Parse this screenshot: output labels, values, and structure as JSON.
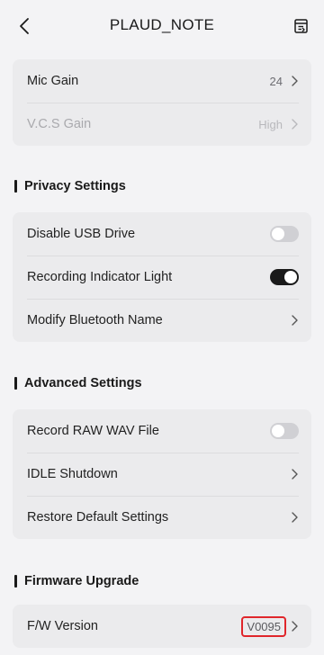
{
  "header": {
    "title": "PLAUD_NOTE",
    "back_icon": "chevron-left-icon",
    "doc_icon": "document-list-icon"
  },
  "gain": {
    "mic_gain": {
      "label": "Mic Gain",
      "value": "24"
    },
    "vcs_gain": {
      "label": "V.C.S Gain",
      "value": "High",
      "disabled": true
    }
  },
  "privacy": {
    "heading": "Privacy Settings",
    "items": [
      {
        "label": "Disable USB Drive",
        "type": "toggle",
        "on": false
      },
      {
        "label": "Recording Indicator Light",
        "type": "toggle",
        "on": true
      },
      {
        "label": "Modify Bluetooth Name",
        "type": "link"
      }
    ]
  },
  "advanced": {
    "heading": "Advanced Settings",
    "items": [
      {
        "label": "Record RAW WAV File",
        "type": "toggle",
        "on": false
      },
      {
        "label": "IDLE Shutdown",
        "type": "link"
      },
      {
        "label": "Restore Default Settings",
        "type": "link"
      }
    ]
  },
  "firmware": {
    "heading": "Firmware Upgrade",
    "version_label": "F/W Version",
    "version_value": "V0095"
  },
  "colors": {
    "background": "#f3f3f5",
    "card": "#ebebed",
    "toggle_on": "#1a1a1a",
    "toggle_off": "#d0d0d4",
    "highlight": "#e0262b"
  }
}
